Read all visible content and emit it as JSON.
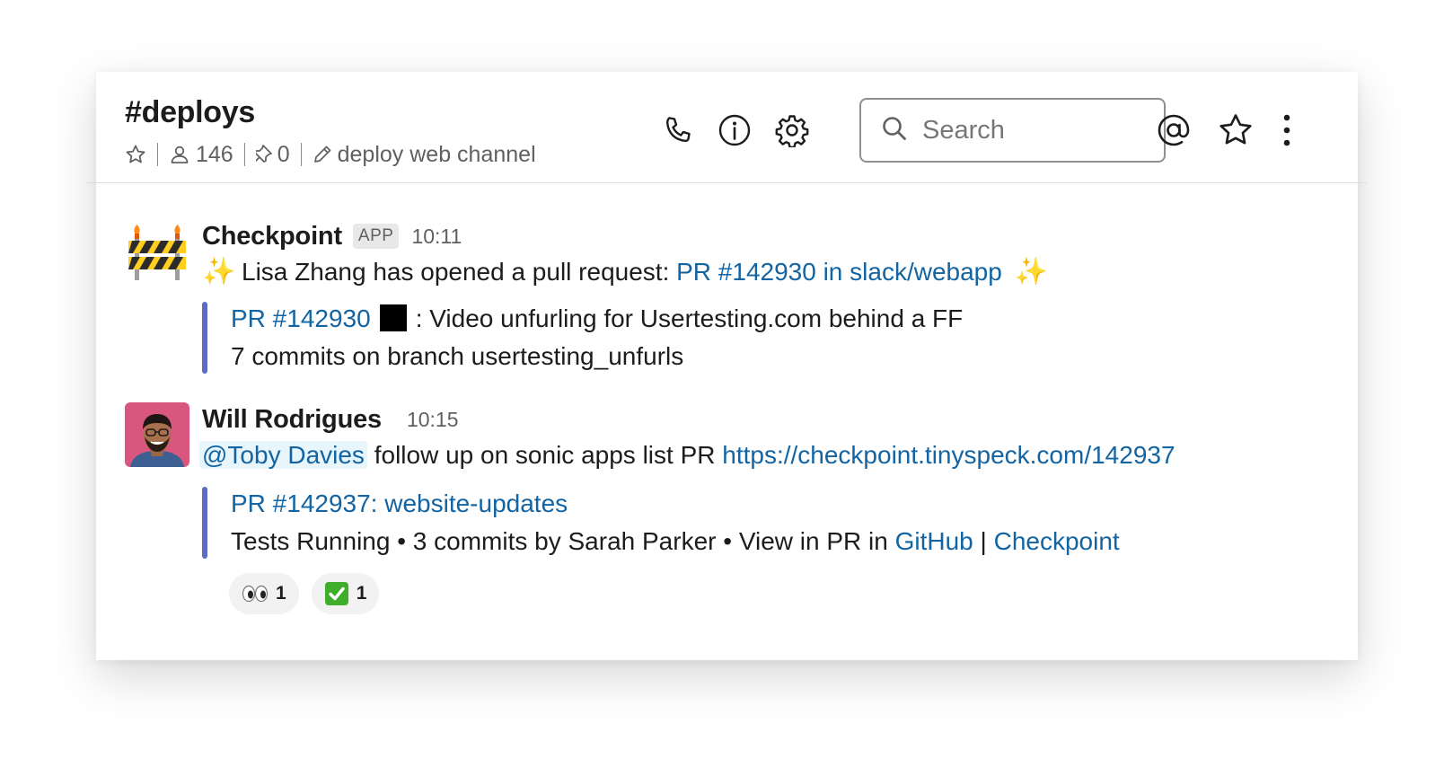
{
  "channel": {
    "name": "#deploys",
    "members": "146",
    "pins": "0",
    "topic": "deploy web channel"
  },
  "search": {
    "placeholder": "Search"
  },
  "icons": {
    "header_left": [
      "star-icon",
      "person-icon",
      "pin-icon",
      "pencil-icon"
    ],
    "header_right": [
      "phone-icon",
      "info-icon",
      "gear-icon",
      "search-icon",
      "at-icon",
      "star-icon",
      "more-vertical-icon"
    ]
  },
  "colors": {
    "link": "#1264a3",
    "attachment_bar": "#5a6dc3",
    "mention_bg": "#e8f5fa"
  },
  "messages": [
    {
      "sender": "Checkpoint",
      "badge": "APP",
      "time": "10:11",
      "avatar": "construction-barrier-icon",
      "text_before": "Lisa Zhang has opened a pull request: ",
      "link": "PR #142930 in slack/webapp",
      "attachment": {
        "pr_link": "PR #142930",
        "title_rest": ": Video unfurling for Usertesting.com behind a FF",
        "line2": "7 commits on branch usertesting_unfurls"
      }
    },
    {
      "sender": "Will Rodrigues",
      "time": "10:15",
      "avatar": "user-avatar",
      "mention": "@Toby Davies",
      "text_mid": " follow up on sonic apps list PR ",
      "url": "https://checkpoint.tinyspeck.com/142937",
      "attachment": {
        "title_link": "PR #142937: website-updates",
        "line2_prefix": "Tests Running • 3 commits by Sarah Parker • View in PR in ",
        "github": "GitHub",
        "sep": " | ",
        "checkpoint": "Checkpoint"
      },
      "reactions": [
        {
          "emoji": "eyes-icon",
          "count": "1"
        },
        {
          "emoji": "check-mark-icon",
          "count": "1"
        }
      ]
    }
  ]
}
